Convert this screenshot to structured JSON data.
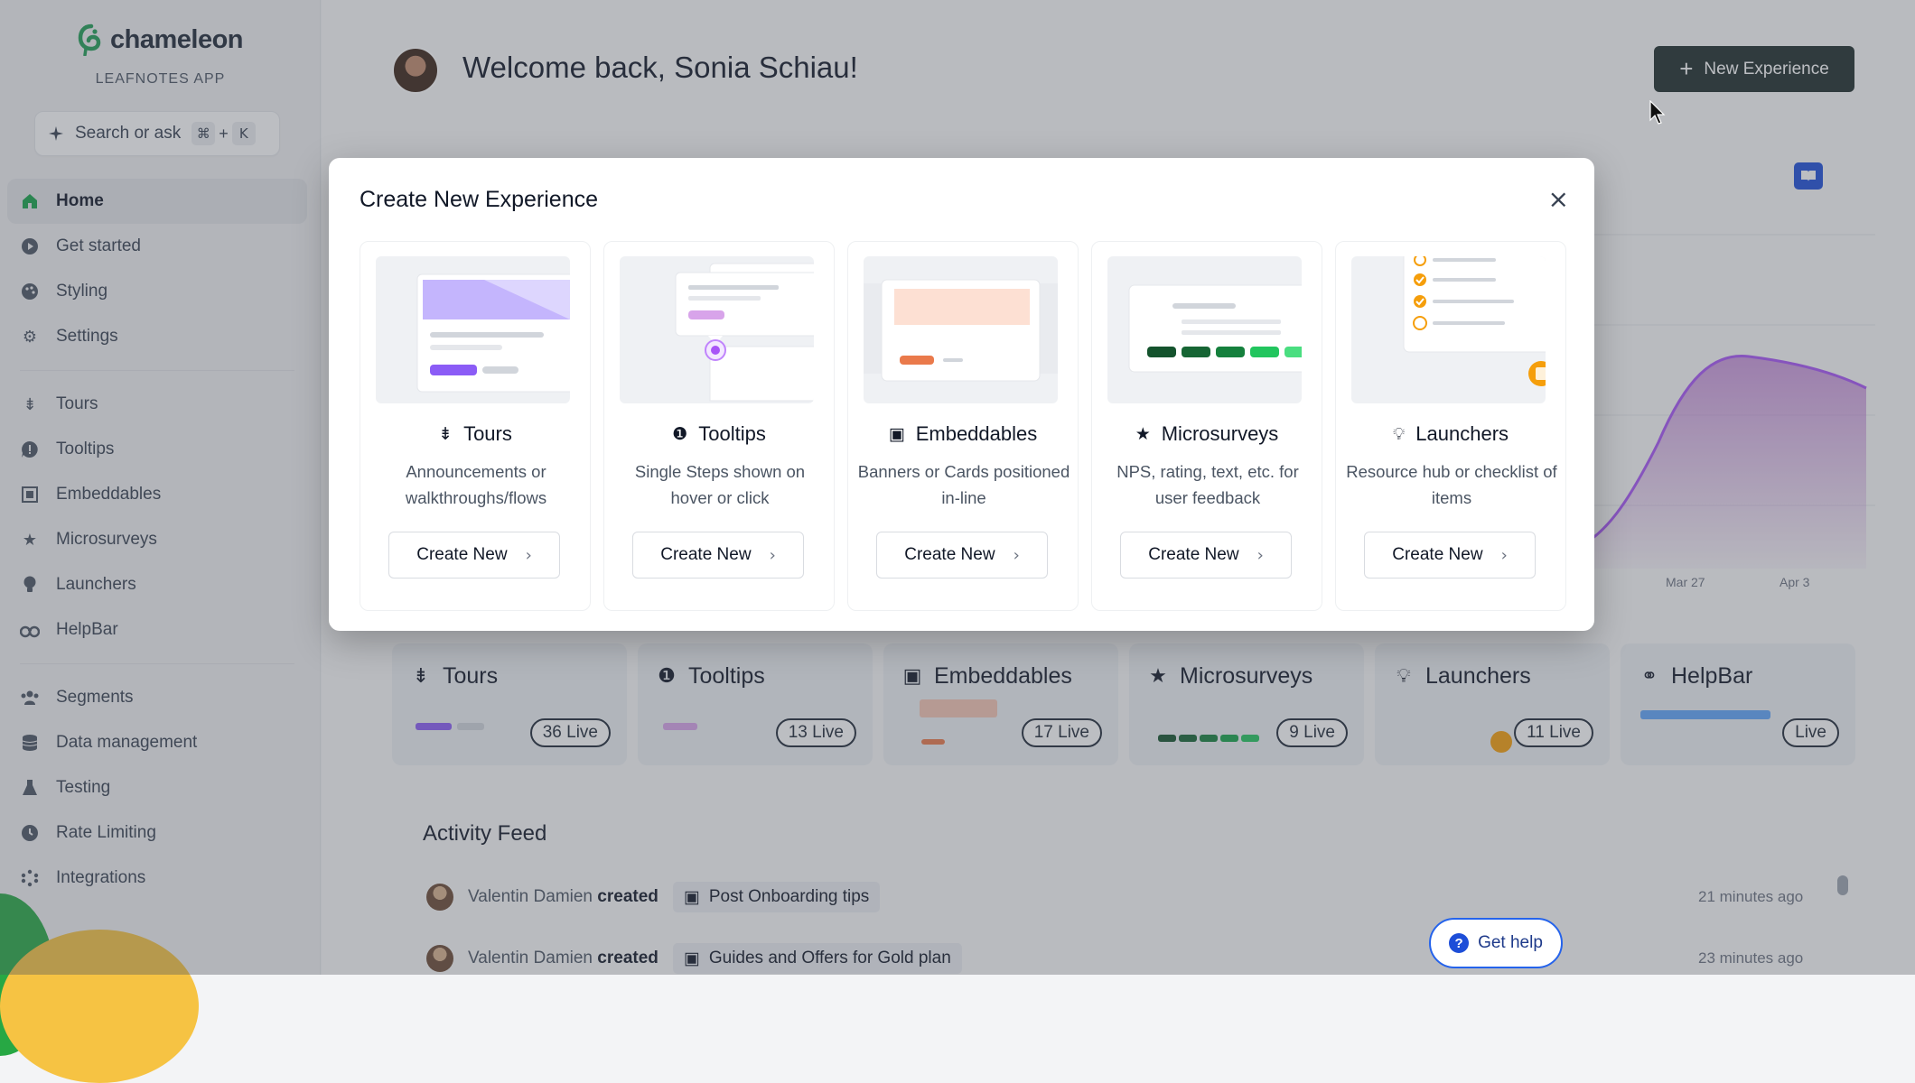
{
  "brand": {
    "name": "chameleon",
    "app": "LEAFNOTES APP",
    "logo_color": "#1f9d55"
  },
  "search": {
    "label": "Search or ask",
    "key1": "⌘",
    "plus": "+",
    "key2": "K"
  },
  "nav": {
    "group1": [
      {
        "label": "Home",
        "icon": "home-icon",
        "active": true
      },
      {
        "label": "Get started",
        "icon": "play-icon"
      },
      {
        "label": "Styling",
        "icon": "palette-icon"
      },
      {
        "label": "Settings",
        "icon": "gear-icon"
      }
    ],
    "group2": [
      {
        "label": "Tours",
        "icon": "signpost-icon"
      },
      {
        "label": "Tooltips",
        "icon": "tooltip-icon"
      },
      {
        "label": "Embeddables",
        "icon": "embed-icon"
      },
      {
        "label": "Microsurveys",
        "icon": "star-icon"
      },
      {
        "label": "Launchers",
        "icon": "bulb-icon"
      },
      {
        "label": "HelpBar",
        "icon": "binoculars-icon"
      }
    ],
    "group3": [
      {
        "label": "Segments",
        "icon": "users-icon"
      },
      {
        "label": "Data management",
        "icon": "database-icon"
      },
      {
        "label": "Testing",
        "icon": "flask-icon"
      },
      {
        "label": "Rate Limiting",
        "icon": "clock-icon"
      },
      {
        "label": "Integrations",
        "icon": "integrations-icon"
      }
    ]
  },
  "header": {
    "welcome": "Welcome back, Sonia Schiau!",
    "new_button": "New Experience"
  },
  "chart": {
    "dates": [
      "Mar 27",
      "Apr 3"
    ]
  },
  "cards": [
    {
      "title": "Tours",
      "icon": "signpost-icon",
      "badge": "36 Live"
    },
    {
      "title": "Tooltips",
      "icon": "tooltip-icon",
      "badge": "13 Live"
    },
    {
      "title": "Embeddables",
      "icon": "embed-icon",
      "badge": "17 Live"
    },
    {
      "title": "Microsurveys",
      "icon": "star-icon",
      "badge": "9 Live"
    },
    {
      "title": "Launchers",
      "icon": "bulb-icon",
      "badge": "11 Live"
    },
    {
      "title": "HelpBar",
      "icon": "binoculars-icon",
      "badge": "Live"
    }
  ],
  "activity": {
    "title": "Activity Feed",
    "items": [
      {
        "user": "Valentin Damien",
        "action": "created",
        "item": "Post Onboarding tips",
        "time": "21 minutes ago"
      },
      {
        "user": "Valentin Damien",
        "action": "created",
        "item": "Guides and Offers for Gold plan",
        "time": "23 minutes ago"
      }
    ]
  },
  "help": {
    "label": "Get help"
  },
  "modal": {
    "title": "Create New Experience",
    "close": "×",
    "options": [
      {
        "name": "Tours",
        "icon": "signpost-icon",
        "desc": "Announcements or walkthroughs/flows",
        "button": "Create New"
      },
      {
        "name": "Tooltips",
        "icon": "tooltip-icon",
        "desc": "Single Steps shown on hover or click",
        "button": "Create New"
      },
      {
        "name": "Embeddables",
        "icon": "embed-icon",
        "desc": "Banners or Cards positioned in-line",
        "button": "Create New"
      },
      {
        "name": "Microsurveys",
        "icon": "star-icon",
        "desc": "NPS, rating, text, etc. for user feedback",
        "button": "Create New"
      },
      {
        "name": "Launchers",
        "icon": "bulb-icon",
        "desc": "Resource hub or checklist of items",
        "button": "Create New"
      }
    ]
  },
  "colors": {
    "primary_dark": "#1e2d2b",
    "tours_purple": "#8b5cf6",
    "survey_green": "#16a34a",
    "embed_orange": "#ea7a4b",
    "help_blue": "#2563eb"
  }
}
